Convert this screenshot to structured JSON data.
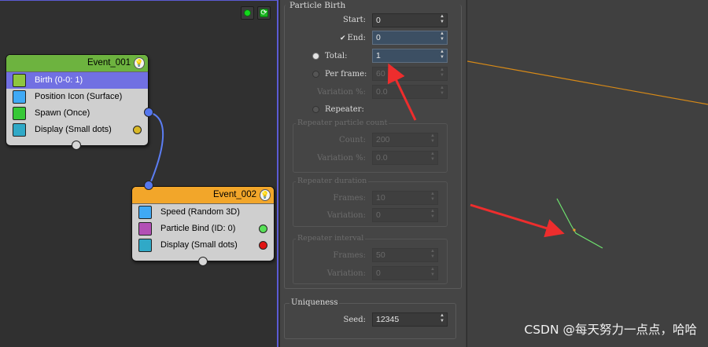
{
  "graph": {
    "toolbar": {
      "run_icon": "green-dot-icon",
      "refresh_icon": "refresh-icon"
    },
    "event_001": {
      "title": "Event_001",
      "header_color": "#6db33f",
      "operators": [
        {
          "label": "Birth (0-0: 1)",
          "icon": "birth-icon",
          "icon_color": "#8ec63f",
          "selected": true
        },
        {
          "label": "Position Icon (Surface)",
          "icon": "position-icon-icon",
          "icon_color": "#3fa9f5"
        },
        {
          "label": "Spawn (Once)",
          "icon": "spawn-icon",
          "icon_color": "#37c837",
          "dot_color": "#4aa0ff"
        },
        {
          "label": "Display (Small dots)",
          "icon": "display-icon",
          "icon_color": "#30a9c7",
          "dot_color": "#d9b827"
        }
      ]
    },
    "event_002": {
      "title": "Event_002",
      "header_color": "#f2a62a",
      "operators": [
        {
          "label": "Speed (Random 3D)",
          "icon": "speed-icon",
          "icon_color": "#3fa9f5"
        },
        {
          "label": "Particle Bind (ID: 0)",
          "icon": "particle-bind-icon",
          "icon_color": "#b24fb5",
          "dot_color": "#58e058"
        },
        {
          "label": "Display (Small dots)",
          "icon": "display-icon",
          "icon_color": "#30a9c7",
          "dot_color": "#e01414"
        }
      ]
    }
  },
  "panel": {
    "rollout_title": "Particle Birth",
    "start": {
      "label": "Start:",
      "value": "0"
    },
    "end": {
      "label": "End:",
      "value": "0",
      "checked": true
    },
    "total": {
      "label": "Total:",
      "value": "1",
      "selected": true
    },
    "per_frame": {
      "label": "Per frame:",
      "value": "60"
    },
    "variation": {
      "label": "Variation %:",
      "value": "0.0"
    },
    "repeater": {
      "label": "Repeater:"
    },
    "repeater_count": {
      "title": "Repeater particle count",
      "count": {
        "label": "Count:",
        "value": "200"
      },
      "variation": {
        "label": "Variation %:",
        "value": "0.0"
      }
    },
    "repeater_duration": {
      "title": "Repeater duration",
      "frames": {
        "label": "Frames:",
        "value": "10"
      },
      "variation": {
        "label": "Variation:",
        "value": "0"
      }
    },
    "repeater_interval": {
      "title": "Repeater interval",
      "frames": {
        "label": "Frames:",
        "value": "50"
      },
      "variation": {
        "label": "Variation:",
        "value": "0"
      }
    },
    "uniqueness": {
      "title": "Uniqueness",
      "seed": {
        "label": "Seed:",
        "value": "12345"
      }
    }
  },
  "viewport": {
    "watermark": "CSDN @每天努力一点点，哈哈"
  }
}
